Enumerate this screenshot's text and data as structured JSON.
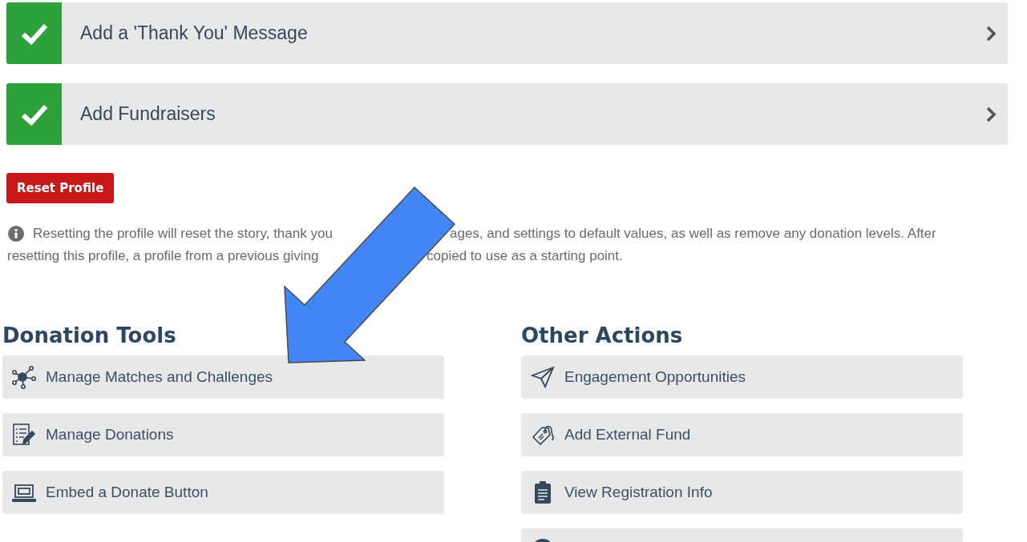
{
  "steps": [
    {
      "label": "Add a 'Thank You' Message",
      "checked": true
    },
    {
      "label": "Add Fundraisers",
      "checked": true
    }
  ],
  "reset_button": "Reset Profile",
  "notice": {
    "lines": [
      [
        "Resetting the profile will reset the story, thank you",
        "ages, and settings to default values, as well as remove any donation levels. After"
      ],
      [
        "resetting this profile, a profile from a previous giving",
        "copied to use as a starting point."
      ]
    ]
  },
  "donation_tools": {
    "title": "Donation Tools",
    "items": [
      {
        "label": "Manage Matches and Challenges"
      },
      {
        "label": "Manage Donations"
      },
      {
        "label": "Embed a Donate Button"
      }
    ]
  },
  "other_actions": {
    "title": "Other Actions",
    "items": [
      {
        "label": "Engagement Opportunities"
      },
      {
        "label": "Add External Fund"
      },
      {
        "label": "View Registration Info"
      }
    ],
    "more_below": true
  }
}
